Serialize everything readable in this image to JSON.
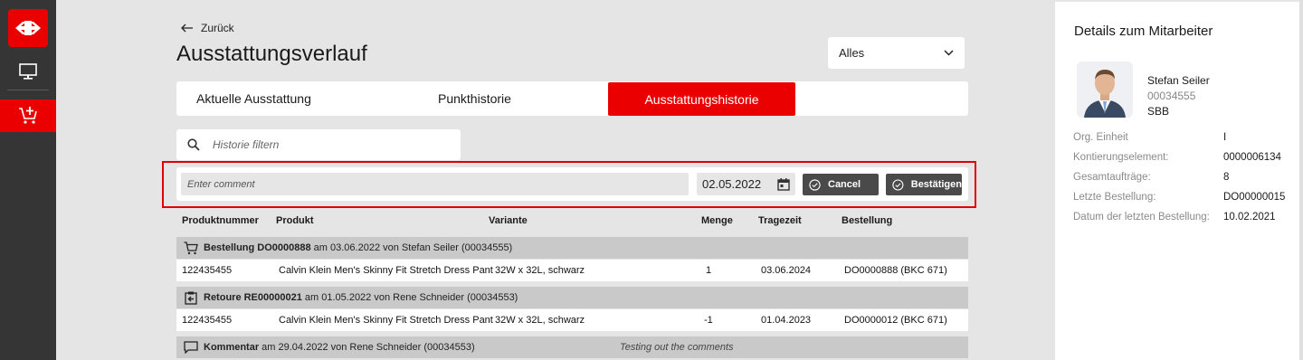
{
  "rail": {
    "brand_color": "#eb0000",
    "items": [
      {
        "icon": "monitor-icon"
      },
      {
        "icon": "cart-add-icon",
        "active": true
      }
    ]
  },
  "header": {
    "back_label": "Zurück",
    "title": "Ausstattungsverlauf",
    "filter_value": "Alles"
  },
  "tabs": [
    {
      "label": "Aktuelle Ausstattung"
    },
    {
      "label": "Punkthistorie"
    },
    {
      "label": "Ausstattungshistorie",
      "active": true
    }
  ],
  "search": {
    "placeholder": "Historie filtern"
  },
  "comment_form": {
    "placeholder": "Enter comment",
    "date": "02.05.2022",
    "cancel_label": "Cancel",
    "confirm_label": "Bestätigen"
  },
  "table": {
    "columns": [
      "Produktnummer",
      "Produkt",
      "Variante",
      "Menge",
      "Tragezeit",
      "Bestellung"
    ],
    "groups": [
      {
        "icon": "cart-icon",
        "title": "Bestellung DO0000888",
        "rest": " am 03.06.2022 von Stefan Seiler (00034555)",
        "rows": [
          {
            "nr": "122435455",
            "product": "Calvin Klein Men's Skinny Fit Stretch Dress Pant",
            "variant": "32W x 32L, schwarz",
            "qty": "1",
            "date": "03.06.2024",
            "order": "DO0000888 (BKC 671)"
          }
        ]
      },
      {
        "icon": "return-icon",
        "title": "Retoure RE00000021",
        "rest": " am 01.05.2022 von Rene Schneider (00034553)",
        "rows": [
          {
            "nr": "122435455",
            "product": "Calvin Klein Men's Skinny Fit Stretch Dress Pant",
            "variant": "32W x 32L, schwarz",
            "qty": "-1",
            "date": "01.04.2023",
            "order": "DO0000012 (BKC 671)"
          }
        ]
      },
      {
        "icon": "comment-icon",
        "title": "Kommentar",
        "rest": " am 29.04.2022 von Rene Schneider (00034553)",
        "note": "Testing out the comments",
        "rows": []
      }
    ]
  },
  "panel": {
    "title": "Details zum Mitarbeiter",
    "name": "Stefan Seiler",
    "id": "00034555",
    "org": "SBB",
    "details": [
      {
        "label": "Org. Einheit",
        "value": "I"
      },
      {
        "label": "Kontierungselement:",
        "value": "0000006134"
      },
      {
        "label": "Gesamtaufträge:",
        "value": "8"
      },
      {
        "label": "Letzte Bestellung:",
        "value": "DO00000015"
      },
      {
        "label": "Datum der letzten Bestellung:",
        "value": "10.02.2021"
      }
    ]
  }
}
